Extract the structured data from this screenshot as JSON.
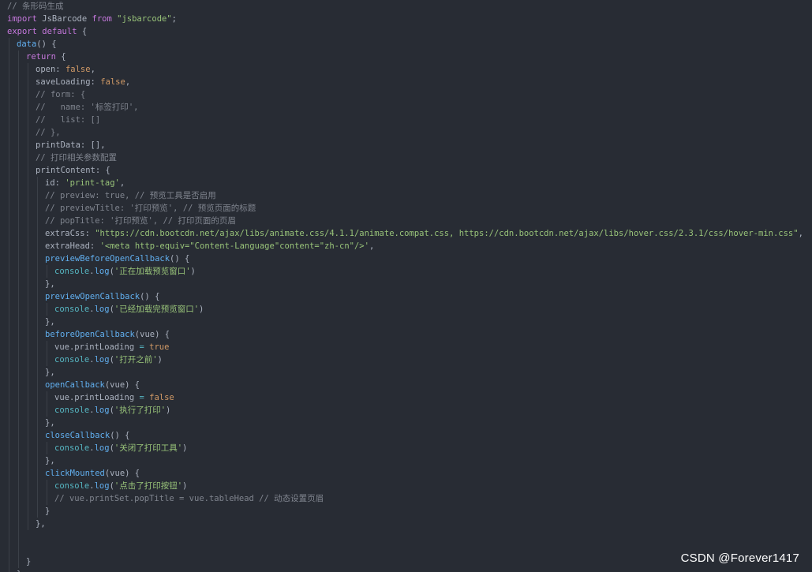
{
  "theme": {
    "background": "#282c34",
    "indent_guide": "#3b4048",
    "comment": "#7f848e",
    "keyword": "#c678dd",
    "literal": "#d19a66",
    "string": "#98c379",
    "function": "#61afef",
    "variable": "#e06c75",
    "operator": "#56b6c2",
    "plain": "#abb2bf"
  },
  "watermark": "CSDN @Forever1417",
  "code": [
    {
      "indent": 0,
      "tokens": [
        {
          "t": "comment",
          "v": "// 条形码生成"
        }
      ]
    },
    {
      "indent": 0,
      "tokens": [
        {
          "t": "keyword",
          "v": "import"
        },
        {
          "t": "plain",
          "v": " "
        },
        {
          "t": "variable",
          "v": "JsBarcode"
        },
        {
          "t": "plain",
          "v": " "
        },
        {
          "t": "keyword",
          "v": "from"
        },
        {
          "t": "plain",
          "v": " "
        },
        {
          "t": "string",
          "v": "\"jsbarcode\""
        },
        {
          "t": "punct",
          "v": ";"
        }
      ]
    },
    {
      "indent": 0,
      "tokens": [
        {
          "t": "keyword",
          "v": "export"
        },
        {
          "t": "plain",
          "v": " "
        },
        {
          "t": "keyword",
          "v": "default"
        },
        {
          "t": "plain",
          "v": " "
        },
        {
          "t": "punct",
          "v": "{"
        }
      ]
    },
    {
      "indent": 1,
      "tokens": [
        {
          "t": "func",
          "v": "data"
        },
        {
          "t": "punct",
          "v": "() {"
        }
      ]
    },
    {
      "indent": 2,
      "tokens": [
        {
          "t": "keyword",
          "v": "return"
        },
        {
          "t": "plain",
          "v": " "
        },
        {
          "t": "punct",
          "v": "{"
        }
      ]
    },
    {
      "indent": 3,
      "tokens": [
        {
          "t": "prop",
          "v": "open"
        },
        {
          "t": "punct",
          "v": ": "
        },
        {
          "t": "literal",
          "v": "false"
        },
        {
          "t": "punct",
          "v": ","
        }
      ]
    },
    {
      "indent": 3,
      "tokens": [
        {
          "t": "prop",
          "v": "saveLoading"
        },
        {
          "t": "punct",
          "v": ": "
        },
        {
          "t": "literal",
          "v": "false"
        },
        {
          "t": "punct",
          "v": ","
        }
      ]
    },
    {
      "indent": 3,
      "tokens": [
        {
          "t": "comment",
          "v": "// form: {"
        }
      ]
    },
    {
      "indent": 3,
      "tokens": [
        {
          "t": "comment",
          "v": "//   name: '标签打印',"
        }
      ]
    },
    {
      "indent": 3,
      "tokens": [
        {
          "t": "comment",
          "v": "//   list: []"
        }
      ]
    },
    {
      "indent": 3,
      "tokens": [
        {
          "t": "comment",
          "v": "// },"
        }
      ]
    },
    {
      "indent": 3,
      "tokens": [
        {
          "t": "prop",
          "v": "printData"
        },
        {
          "t": "punct",
          "v": ": [],"
        }
      ]
    },
    {
      "indent": 3,
      "tokens": [
        {
          "t": "comment",
          "v": "// 打印相关参数配置"
        }
      ]
    },
    {
      "indent": 3,
      "tokens": [
        {
          "t": "prop",
          "v": "printContent"
        },
        {
          "t": "punct",
          "v": ": {"
        }
      ]
    },
    {
      "indent": 4,
      "tokens": [
        {
          "t": "prop",
          "v": "id"
        },
        {
          "t": "punct",
          "v": ": "
        },
        {
          "t": "string",
          "v": "'print-tag'"
        },
        {
          "t": "punct",
          "v": ","
        }
      ]
    },
    {
      "indent": 4,
      "tokens": [
        {
          "t": "comment",
          "v": "// preview: true, // 预览工具是否启用"
        }
      ]
    },
    {
      "indent": 4,
      "tokens": [
        {
          "t": "comment",
          "v": "// previewTitle: '打印预览', // 预览页面的标题"
        }
      ]
    },
    {
      "indent": 4,
      "tokens": [
        {
          "t": "comment",
          "v": "// popTitle: '打印预览', // 打印页面的页眉"
        }
      ]
    },
    {
      "indent": 4,
      "tokens": [
        {
          "t": "prop",
          "v": "extraCss"
        },
        {
          "t": "punct",
          "v": ": "
        },
        {
          "t": "string",
          "v": "\"https://cdn.bootcdn.net/ajax/libs/animate.css/4.1.1/animate.compat.css, https://cdn.bootcdn.net/ajax/libs/hover.css/2.3.1/css/hover-min.css\""
        },
        {
          "t": "punct",
          "v": ","
        }
      ]
    },
    {
      "indent": 4,
      "tokens": [
        {
          "t": "prop",
          "v": "extraHead"
        },
        {
          "t": "punct",
          "v": ": "
        },
        {
          "t": "string",
          "v": "'<meta http-equiv=\"Content-Language\"content=\"zh-cn\"/>'"
        },
        {
          "t": "punct",
          "v": ","
        }
      ]
    },
    {
      "indent": 4,
      "tokens": [
        {
          "t": "func",
          "v": "previewBeforeOpenCallback"
        },
        {
          "t": "punct",
          "v": "() {"
        }
      ]
    },
    {
      "indent": 5,
      "tokens": [
        {
          "t": "operator",
          "v": "console"
        },
        {
          "t": "punct",
          "v": "."
        },
        {
          "t": "func",
          "v": "log"
        },
        {
          "t": "punct",
          "v": "("
        },
        {
          "t": "string",
          "v": "'正在加载预览窗口'"
        },
        {
          "t": "punct",
          "v": ")"
        }
      ]
    },
    {
      "indent": 4,
      "tokens": [
        {
          "t": "punct",
          "v": "},"
        }
      ]
    },
    {
      "indent": 4,
      "tokens": [
        {
          "t": "func",
          "v": "previewOpenCallback"
        },
        {
          "t": "punct",
          "v": "() {"
        }
      ]
    },
    {
      "indent": 5,
      "tokens": [
        {
          "t": "operator",
          "v": "console"
        },
        {
          "t": "punct",
          "v": "."
        },
        {
          "t": "func",
          "v": "log"
        },
        {
          "t": "punct",
          "v": "("
        },
        {
          "t": "string",
          "v": "'已经加载完预览窗口'"
        },
        {
          "t": "punct",
          "v": ")"
        }
      ]
    },
    {
      "indent": 4,
      "tokens": [
        {
          "t": "punct",
          "v": "},"
        }
      ]
    },
    {
      "indent": 4,
      "tokens": [
        {
          "t": "func",
          "v": "beforeOpenCallback"
        },
        {
          "t": "punct",
          "v": "(vue) {"
        }
      ]
    },
    {
      "indent": 5,
      "tokens": [
        {
          "t": "variable",
          "v": "vue"
        },
        {
          "t": "punct",
          "v": "."
        },
        {
          "t": "variable",
          "v": "printLoading"
        },
        {
          "t": "plain",
          "v": " "
        },
        {
          "t": "operator",
          "v": "="
        },
        {
          "t": "plain",
          "v": " "
        },
        {
          "t": "literal",
          "v": "true"
        }
      ]
    },
    {
      "indent": 5,
      "tokens": [
        {
          "t": "operator",
          "v": "console"
        },
        {
          "t": "punct",
          "v": "."
        },
        {
          "t": "func",
          "v": "log"
        },
        {
          "t": "punct",
          "v": "("
        },
        {
          "t": "string",
          "v": "'打开之前'"
        },
        {
          "t": "punct",
          "v": ")"
        }
      ]
    },
    {
      "indent": 4,
      "tokens": [
        {
          "t": "punct",
          "v": "},"
        }
      ]
    },
    {
      "indent": 4,
      "tokens": [
        {
          "t": "func",
          "v": "openCallback"
        },
        {
          "t": "punct",
          "v": "(vue) {"
        }
      ]
    },
    {
      "indent": 5,
      "tokens": [
        {
          "t": "variable",
          "v": "vue"
        },
        {
          "t": "punct",
          "v": "."
        },
        {
          "t": "variable",
          "v": "printLoading"
        },
        {
          "t": "plain",
          "v": " "
        },
        {
          "t": "operator",
          "v": "="
        },
        {
          "t": "plain",
          "v": " "
        },
        {
          "t": "literal",
          "v": "false"
        }
      ]
    },
    {
      "indent": 5,
      "tokens": [
        {
          "t": "operator",
          "v": "console"
        },
        {
          "t": "punct",
          "v": "."
        },
        {
          "t": "func",
          "v": "log"
        },
        {
          "t": "punct",
          "v": "("
        },
        {
          "t": "string",
          "v": "'执行了打印'"
        },
        {
          "t": "punct",
          "v": ")"
        }
      ]
    },
    {
      "indent": 4,
      "tokens": [
        {
          "t": "punct",
          "v": "},"
        }
      ]
    },
    {
      "indent": 4,
      "tokens": [
        {
          "t": "func",
          "v": "closeCallback"
        },
        {
          "t": "punct",
          "v": "() {"
        }
      ]
    },
    {
      "indent": 5,
      "tokens": [
        {
          "t": "operator",
          "v": "console"
        },
        {
          "t": "punct",
          "v": "."
        },
        {
          "t": "func",
          "v": "log"
        },
        {
          "t": "punct",
          "v": "("
        },
        {
          "t": "string",
          "v": "'关闭了打印工具'"
        },
        {
          "t": "punct",
          "v": ")"
        }
      ]
    },
    {
      "indent": 4,
      "tokens": [
        {
          "t": "punct",
          "v": "},"
        }
      ]
    },
    {
      "indent": 4,
      "tokens": [
        {
          "t": "func",
          "v": "clickMounted"
        },
        {
          "t": "punct",
          "v": "(vue) {"
        }
      ]
    },
    {
      "indent": 5,
      "tokens": [
        {
          "t": "operator",
          "v": "console"
        },
        {
          "t": "punct",
          "v": "."
        },
        {
          "t": "func",
          "v": "log"
        },
        {
          "t": "punct",
          "v": "("
        },
        {
          "t": "string",
          "v": "'点击了打印按钮'"
        },
        {
          "t": "punct",
          "v": ")"
        }
      ]
    },
    {
      "indent": 5,
      "tokens": [
        {
          "t": "comment",
          "v": "// vue.printSet.popTitle = vue.tableHead // 动态设置页眉"
        }
      ]
    },
    {
      "indent": 4,
      "tokens": [
        {
          "t": "punct",
          "v": "}"
        }
      ]
    },
    {
      "indent": 3,
      "tokens": [
        {
          "t": "punct",
          "v": "},"
        }
      ]
    },
    {
      "indent": 2,
      "tokens": []
    },
    {
      "indent": 2,
      "tokens": []
    },
    {
      "indent": 2,
      "tokens": [
        {
          "t": "punct",
          "v": "}"
        }
      ]
    },
    {
      "indent": 1,
      "tokens": [
        {
          "t": "punct",
          "v": "}"
        }
      ]
    }
  ]
}
